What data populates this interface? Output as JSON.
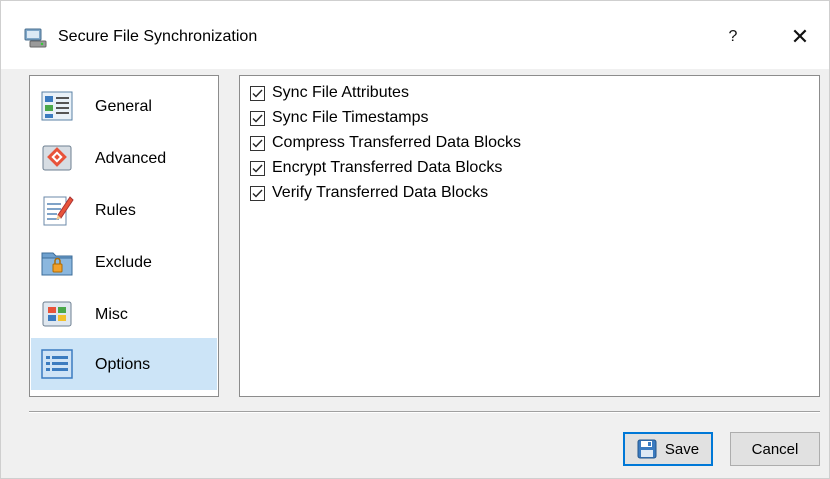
{
  "window": {
    "title": "Secure File Synchronization",
    "help_label": "?",
    "close_label": "✕"
  },
  "sidebar": {
    "items": [
      {
        "label": "General",
        "icon": "general-icon",
        "selected": false
      },
      {
        "label": "Advanced",
        "icon": "advanced-icon",
        "selected": false
      },
      {
        "label": "Rules",
        "icon": "rules-icon",
        "selected": false
      },
      {
        "label": "Exclude",
        "icon": "exclude-folder-icon",
        "selected": false
      },
      {
        "label": "Misc",
        "icon": "misc-icon",
        "selected": false
      },
      {
        "label": "Options",
        "icon": "options-icon",
        "selected": true
      }
    ]
  },
  "options": [
    {
      "label": "Sync File Attributes",
      "checked": true
    },
    {
      "label": "Sync File Timestamps",
      "checked": true
    },
    {
      "label": "Compress Transferred Data Blocks",
      "checked": true
    },
    {
      "label": "Encrypt Transferred Data Blocks",
      "checked": true
    },
    {
      "label": "Verify Transferred Data Blocks",
      "checked": true
    }
  ],
  "buttons": {
    "save_label": "Save",
    "cancel_label": "Cancel"
  },
  "colors": {
    "selected_bg": "#cce4f7",
    "accent": "#0078d7"
  }
}
